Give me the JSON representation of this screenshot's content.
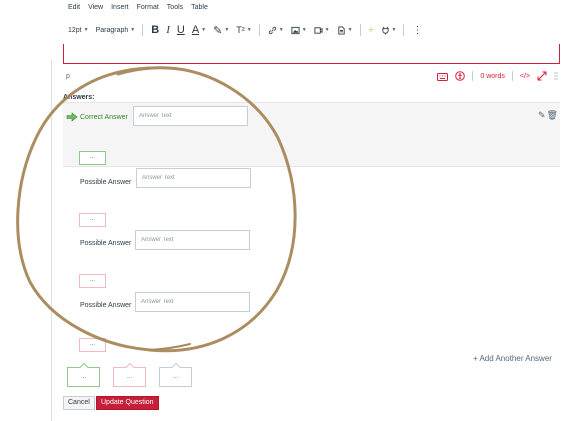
{
  "menu": [
    "Edit",
    "View",
    "Insert",
    "Format",
    "Tools",
    "Table"
  ],
  "toolbar": {
    "font_size": "12pt",
    "block_format": "Paragraph",
    "bold": "B",
    "italic": "I",
    "underline": "U",
    "text_color": "A",
    "superscript": "T²",
    "more": "⋮"
  },
  "status_bar": {
    "path": "p",
    "word_count": "0 words",
    "html_toggle": "</>"
  },
  "answers": {
    "label": "Answers:",
    "correct": {
      "label": "Correct Answer",
      "placeholder": "Answer Text",
      "comment_button": "..."
    },
    "possible": [
      {
        "label": "Possible Answer",
        "placeholder": "Answer Text",
        "comment_button": "..."
      },
      {
        "label": "Possible Answer",
        "placeholder": "Answer Text",
        "comment_button": "..."
      },
      {
        "label": "Possible Answer",
        "placeholder": "Answer Text",
        "comment_button": "..."
      }
    ],
    "add_another": "+ Add Another Answer"
  },
  "feedback_boxes": [
    "...",
    "...",
    "..."
  ],
  "actions": {
    "cancel": "Cancel",
    "update": "Update Question"
  },
  "colors": {
    "accent_red": "#d0213a",
    "correct_green": "#35852a",
    "annotation_brown": "#a8875a",
    "update_button_bg": "#c71f3a"
  },
  "icons": {
    "correct_marker": "arrow-right-icon",
    "edit": "pencil-icon",
    "delete": "trash-icon",
    "a11y_checker": "accessibility-icon",
    "fullscreen": "expand-icon",
    "resize": "drag-handle-icon"
  }
}
